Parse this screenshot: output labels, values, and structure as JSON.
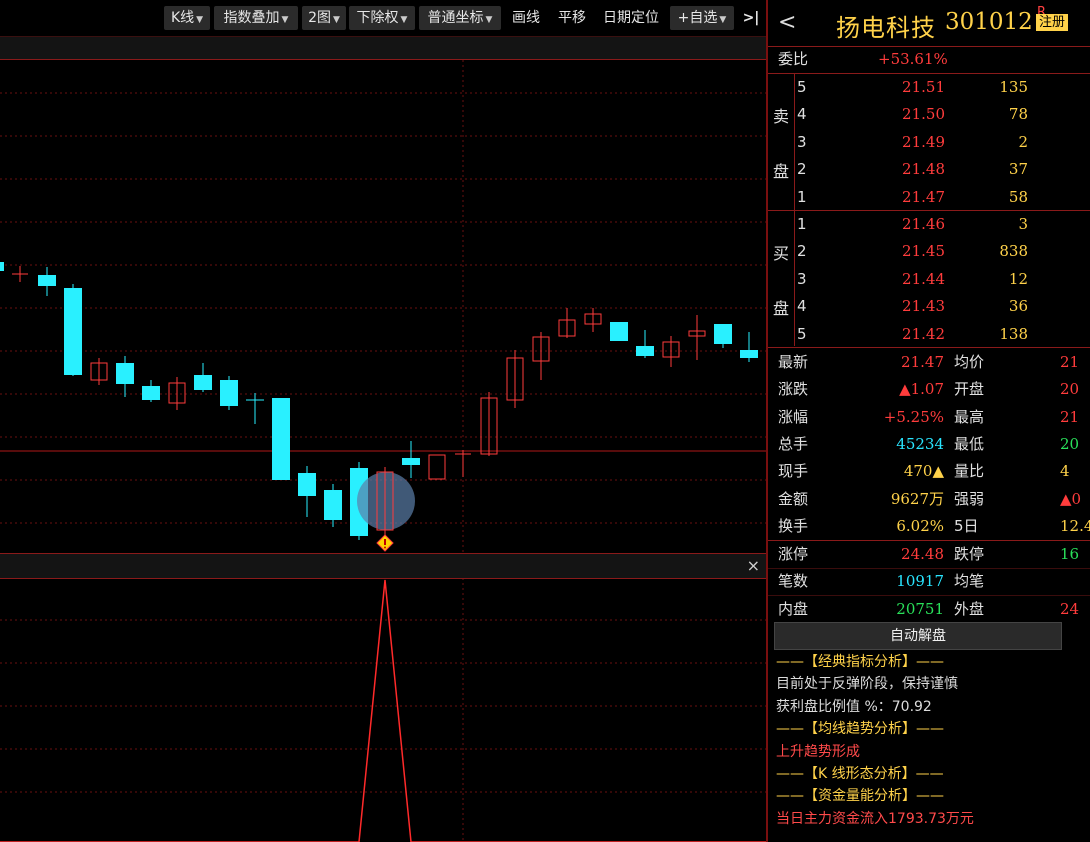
{
  "toolbar": {
    "kline": "K线",
    "index_overlay": "指数叠加",
    "two_charts": "2图",
    "adjust": "下除权",
    "coord": "普通坐标",
    "draw": "画线",
    "pan": "平移",
    "date_locate": "日期定位",
    "add_fav": "+自选",
    "more_icon": ">|"
  },
  "indicator_close": "×",
  "stock": {
    "name": "扬电科技",
    "code": "301012",
    "r_mark": "R",
    "register": "注册"
  },
  "ratio": {
    "label": "委比",
    "value": "+53.61%"
  },
  "sell_label": [
    "卖",
    "盘"
  ],
  "buy_label": [
    "买",
    "盘"
  ],
  "sell": [
    {
      "level": "5",
      "price": "21.51",
      "vol": "135"
    },
    {
      "level": "4",
      "price": "21.50",
      "vol": "78"
    },
    {
      "level": "3",
      "price": "21.49",
      "vol": "2"
    },
    {
      "level": "2",
      "price": "21.48",
      "vol": "37"
    },
    {
      "level": "1",
      "price": "21.47",
      "vol": "58"
    }
  ],
  "buy": [
    {
      "level": "1",
      "price": "21.46",
      "vol": "3"
    },
    {
      "level": "2",
      "price": "21.45",
      "vol": "838"
    },
    {
      "level": "3",
      "price": "21.44",
      "vol": "12"
    },
    {
      "level": "4",
      "price": "21.43",
      "vol": "36"
    },
    {
      "level": "5",
      "price": "21.42",
      "vol": "138"
    }
  ],
  "quote": [
    {
      "l1": "最新",
      "v1": "21.47",
      "l2": "均价",
      "v2": "21"
    },
    {
      "l1": "涨跌",
      "v1": "▲1.07",
      "l2": "开盘",
      "v2": "20"
    },
    {
      "l1": "涨幅",
      "v1": "+5.25%",
      "l2": "最高",
      "v2": "21"
    },
    {
      "l1": "总手",
      "v1": "45234",
      "l2": "最低",
      "v2": "20"
    },
    {
      "l1": "现手",
      "v1": "470▲",
      "l2": "量比",
      "v2": "4"
    },
    {
      "l1": "金额",
      "v1": "9627万",
      "l2": "强弱",
      "v2": "▲0"
    },
    {
      "l1": "换手",
      "v1": "6.02%",
      "l2": "5日",
      "v2": "12.4"
    }
  ],
  "quote2": [
    {
      "l1": "涨停",
      "v1": "24.48",
      "l2": "跌停",
      "v2": "16"
    },
    {
      "l1": "笔数",
      "v1": "10917",
      "l2": "均笔",
      "v2": ""
    },
    {
      "l1": "内盘",
      "v1": "20751",
      "l2": "外盘",
      "v2": "24"
    }
  ],
  "auto_btn": "自动解盘",
  "analysis": [
    "——【经典指标分析】——",
    "目前处于反弹阶段，保持谨慎",
    "获利盘比例值 %：70.92",
    "——【均线趋势分析】——",
    "上升趋势形成",
    "——【K 线形态分析】——",
    "——【资金量能分析】——",
    "当日主力资金流入1793.73万元"
  ],
  "colors": {
    "up": "#ff3c3c",
    "down": "#29f0ff",
    "grid": "#8a1a1a",
    "header_yellow": "#ffd24a"
  }
}
